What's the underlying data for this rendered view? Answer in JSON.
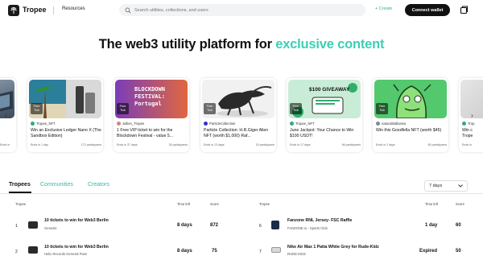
{
  "header": {
    "brand": "Tropee",
    "resources": "Resources",
    "search_placeholder": "Search utilities, collections, and users",
    "create": "+ Create",
    "connect_wallet": "Connect wallet"
  },
  "hero": {
    "title_prefix": "The web3 utility platform for ",
    "title_accent": "exclusive content"
  },
  "carousel": {
    "cards": [
      {
        "creator": "Tropee_NFT",
        "badge": "Free Tick",
        "title": "Win an Exclusive Ledger Nano X (The Sandbox Edition)",
        "ends": "Ends in 1 day",
        "participants": "172 participants"
      },
      {
        "creator": "Jullien_Tropee",
        "badge": "Free Tick",
        "title": "1 Free VIP ticket to win for the Blockdown Festival - value 5...",
        "ends": "Ends in 37 days",
        "participants": "35 participants",
        "thumb_text": "BLOCKDOWN FESTIVAL: Portugal"
      },
      {
        "creator": "ParticleCollection",
        "badge": "Free Tick",
        "title": "Particle Collection: H.R.Giger Alien NFT (worth $1,000) Raf...",
        "ends": "Ends in 13 days",
        "participants": "15 participants"
      },
      {
        "creator": "Tropee_NFT",
        "badge": "Free Tick",
        "title": "June Jackpot: Your Chance to Win $100 USDT!",
        "ends": "Ends in 17 days",
        "participants": "96 participants",
        "thumb_text": "$100 GIVEAWAY"
      },
      {
        "creator": "naturalistdlanow",
        "badge": "Free Tick",
        "title": "Win this Goodfella NFT (worth $45)",
        "ends": "Ends in 2 days",
        "participants": "80 participants"
      }
    ],
    "left_partial": {
      "ends": "Ends in",
      "participants": "participants"
    },
    "right_partial": {
      "creator": "Trop",
      "title1": "Win c",
      "title2": "Trope",
      "ends": "Ends in"
    }
  },
  "tabs": [
    {
      "label": "Tropees"
    },
    {
      "label": "Communities"
    },
    {
      "label": "Creators"
    }
  ],
  "period_select": "7 days",
  "table": {
    "headers": {
      "rank": "Tropee",
      "time": "Time left",
      "score": "Score"
    },
    "left_rows": [
      {
        "rank": "1",
        "name": "10 tickets to win for Web3 Berlin",
        "sub": "Genesis",
        "time": "8 days",
        "score": "872"
      },
      {
        "rank": "2",
        "name": "10 tickets to win for Web3 Berlin",
        "sub": "Helix Records Genesis Pass",
        "time": "8 days",
        "score": "75"
      }
    ],
    "right_rows": [
      {
        "rank": "6",
        "name": "Fanzone RNL Jersey- FSC Raffle",
        "sub": "FANZONE.io - Sports Club",
        "time": "1 day",
        "score": "60"
      },
      {
        "rank": "7",
        "name": "Nike Air Max 1 Patta White Grey for Rude-Kidz",
        "sub": "RUDE-KIDZ",
        "time": "Expired",
        "score": "50"
      }
    ]
  },
  "colors": {
    "accent": "#3ccfb4",
    "dark": "#111111"
  }
}
